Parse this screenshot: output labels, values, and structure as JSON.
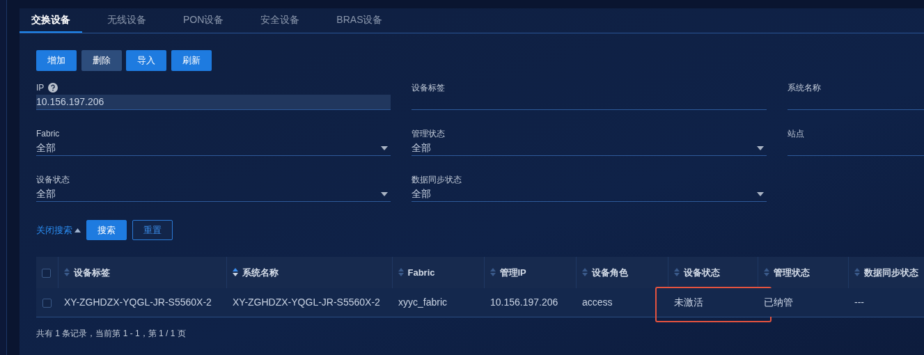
{
  "tabs": [
    {
      "label": "交换设备",
      "selected": true
    },
    {
      "label": "无线设备",
      "selected": false
    },
    {
      "label": "PON设备",
      "selected": false
    },
    {
      "label": "安全设备",
      "selected": false
    },
    {
      "label": "BRAS设备",
      "selected": false
    }
  ],
  "toolbar": [
    {
      "label": "增加",
      "kind": "primary"
    },
    {
      "label": "删除",
      "kind": "muted"
    },
    {
      "label": "导入",
      "kind": "primary"
    },
    {
      "label": "刷新",
      "kind": "primary"
    }
  ],
  "filters": [
    {
      "label": "IP",
      "kind": "text",
      "help": true,
      "value": "10.156.197.206",
      "highlighted": true
    },
    {
      "label": "设备标签",
      "kind": "text",
      "highlighted": false
    },
    {
      "label": "系统名称",
      "kind": "text",
      "highlighted": false
    },
    {
      "label": "Fabric",
      "kind": "select",
      "value": "全部"
    },
    {
      "label": "管理状态",
      "kind": "select",
      "value": "全部"
    },
    {
      "label": "站点",
      "kind": "text",
      "highlighted": false
    },
    {
      "label": "设备状态",
      "kind": "select",
      "value": "全部"
    },
    {
      "label": "数据同步状态",
      "kind": "select",
      "value": "全部"
    }
  ],
  "search_actions": {
    "toggle": "关闭搜索",
    "expanded": true,
    "search": "搜索",
    "reset": "重置"
  },
  "table": {
    "all_checked": false,
    "columns": [
      {
        "label": "设备标签",
        "sorted": false
      },
      {
        "label": "系统名称",
        "sorted": true
      },
      {
        "label": "Fabric",
        "sorted": false
      },
      {
        "label": "管理IP",
        "sorted": false
      },
      {
        "label": "设备角色",
        "sorted": false
      },
      {
        "label": "设备状态",
        "sorted": false
      },
      {
        "label": "管理状态",
        "sorted": false
      },
      {
        "label": "数据同步状态",
        "sorted": false
      }
    ],
    "rows": [
      {
        "checked": false,
        "cells": [
          {
            "text": "XY-ZGHDZX-YQGL-JR-S5560X-2",
            "highlighted": false
          },
          {
            "text": "XY-ZGHDZX-YQGL-JR-S5560X-2",
            "highlighted": false
          },
          {
            "text": "xyyc_fabric",
            "highlighted": false
          },
          {
            "text": "10.156.197.206",
            "highlighted": false
          },
          {
            "text": "access",
            "highlighted": false
          },
          {
            "text": "未激活",
            "highlighted": true
          },
          {
            "text": "已纳管",
            "highlighted": false
          },
          {
            "text": "---",
            "highlighted": false
          }
        ]
      }
    ]
  },
  "pagination": "共有 1 条记录，当前第 1 - 1，第 1 / 1 页"
}
